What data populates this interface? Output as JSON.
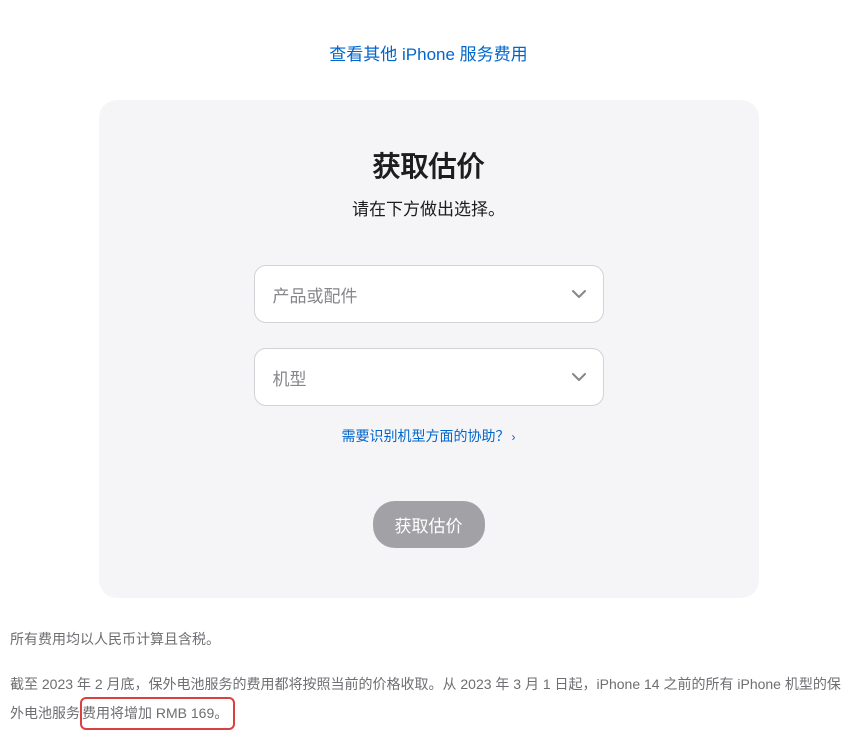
{
  "topLink": {
    "label": "查看其他 iPhone 服务费用"
  },
  "card": {
    "title": "获取估价",
    "subtitle": "请在下方做出选择。",
    "selects": {
      "product": {
        "placeholder": "产品或配件"
      },
      "model": {
        "placeholder": "机型"
      }
    },
    "helpLink": {
      "label": "需要识别机型方面的协助？",
      "arrow": "›"
    },
    "submitLabel": "获取估价"
  },
  "footnotes": {
    "n1": "所有费用均以人民币计算且含税。",
    "n2a": "截至 2023 年 2 月底，保外电池服务的费用都将按照当前的价格收取。从 2023 年 3 月 1 日起，iPhone 14 之前的所有 iPhone 机型的保外电池服务",
    "n2b": "费用将增加 RMB 169。"
  }
}
